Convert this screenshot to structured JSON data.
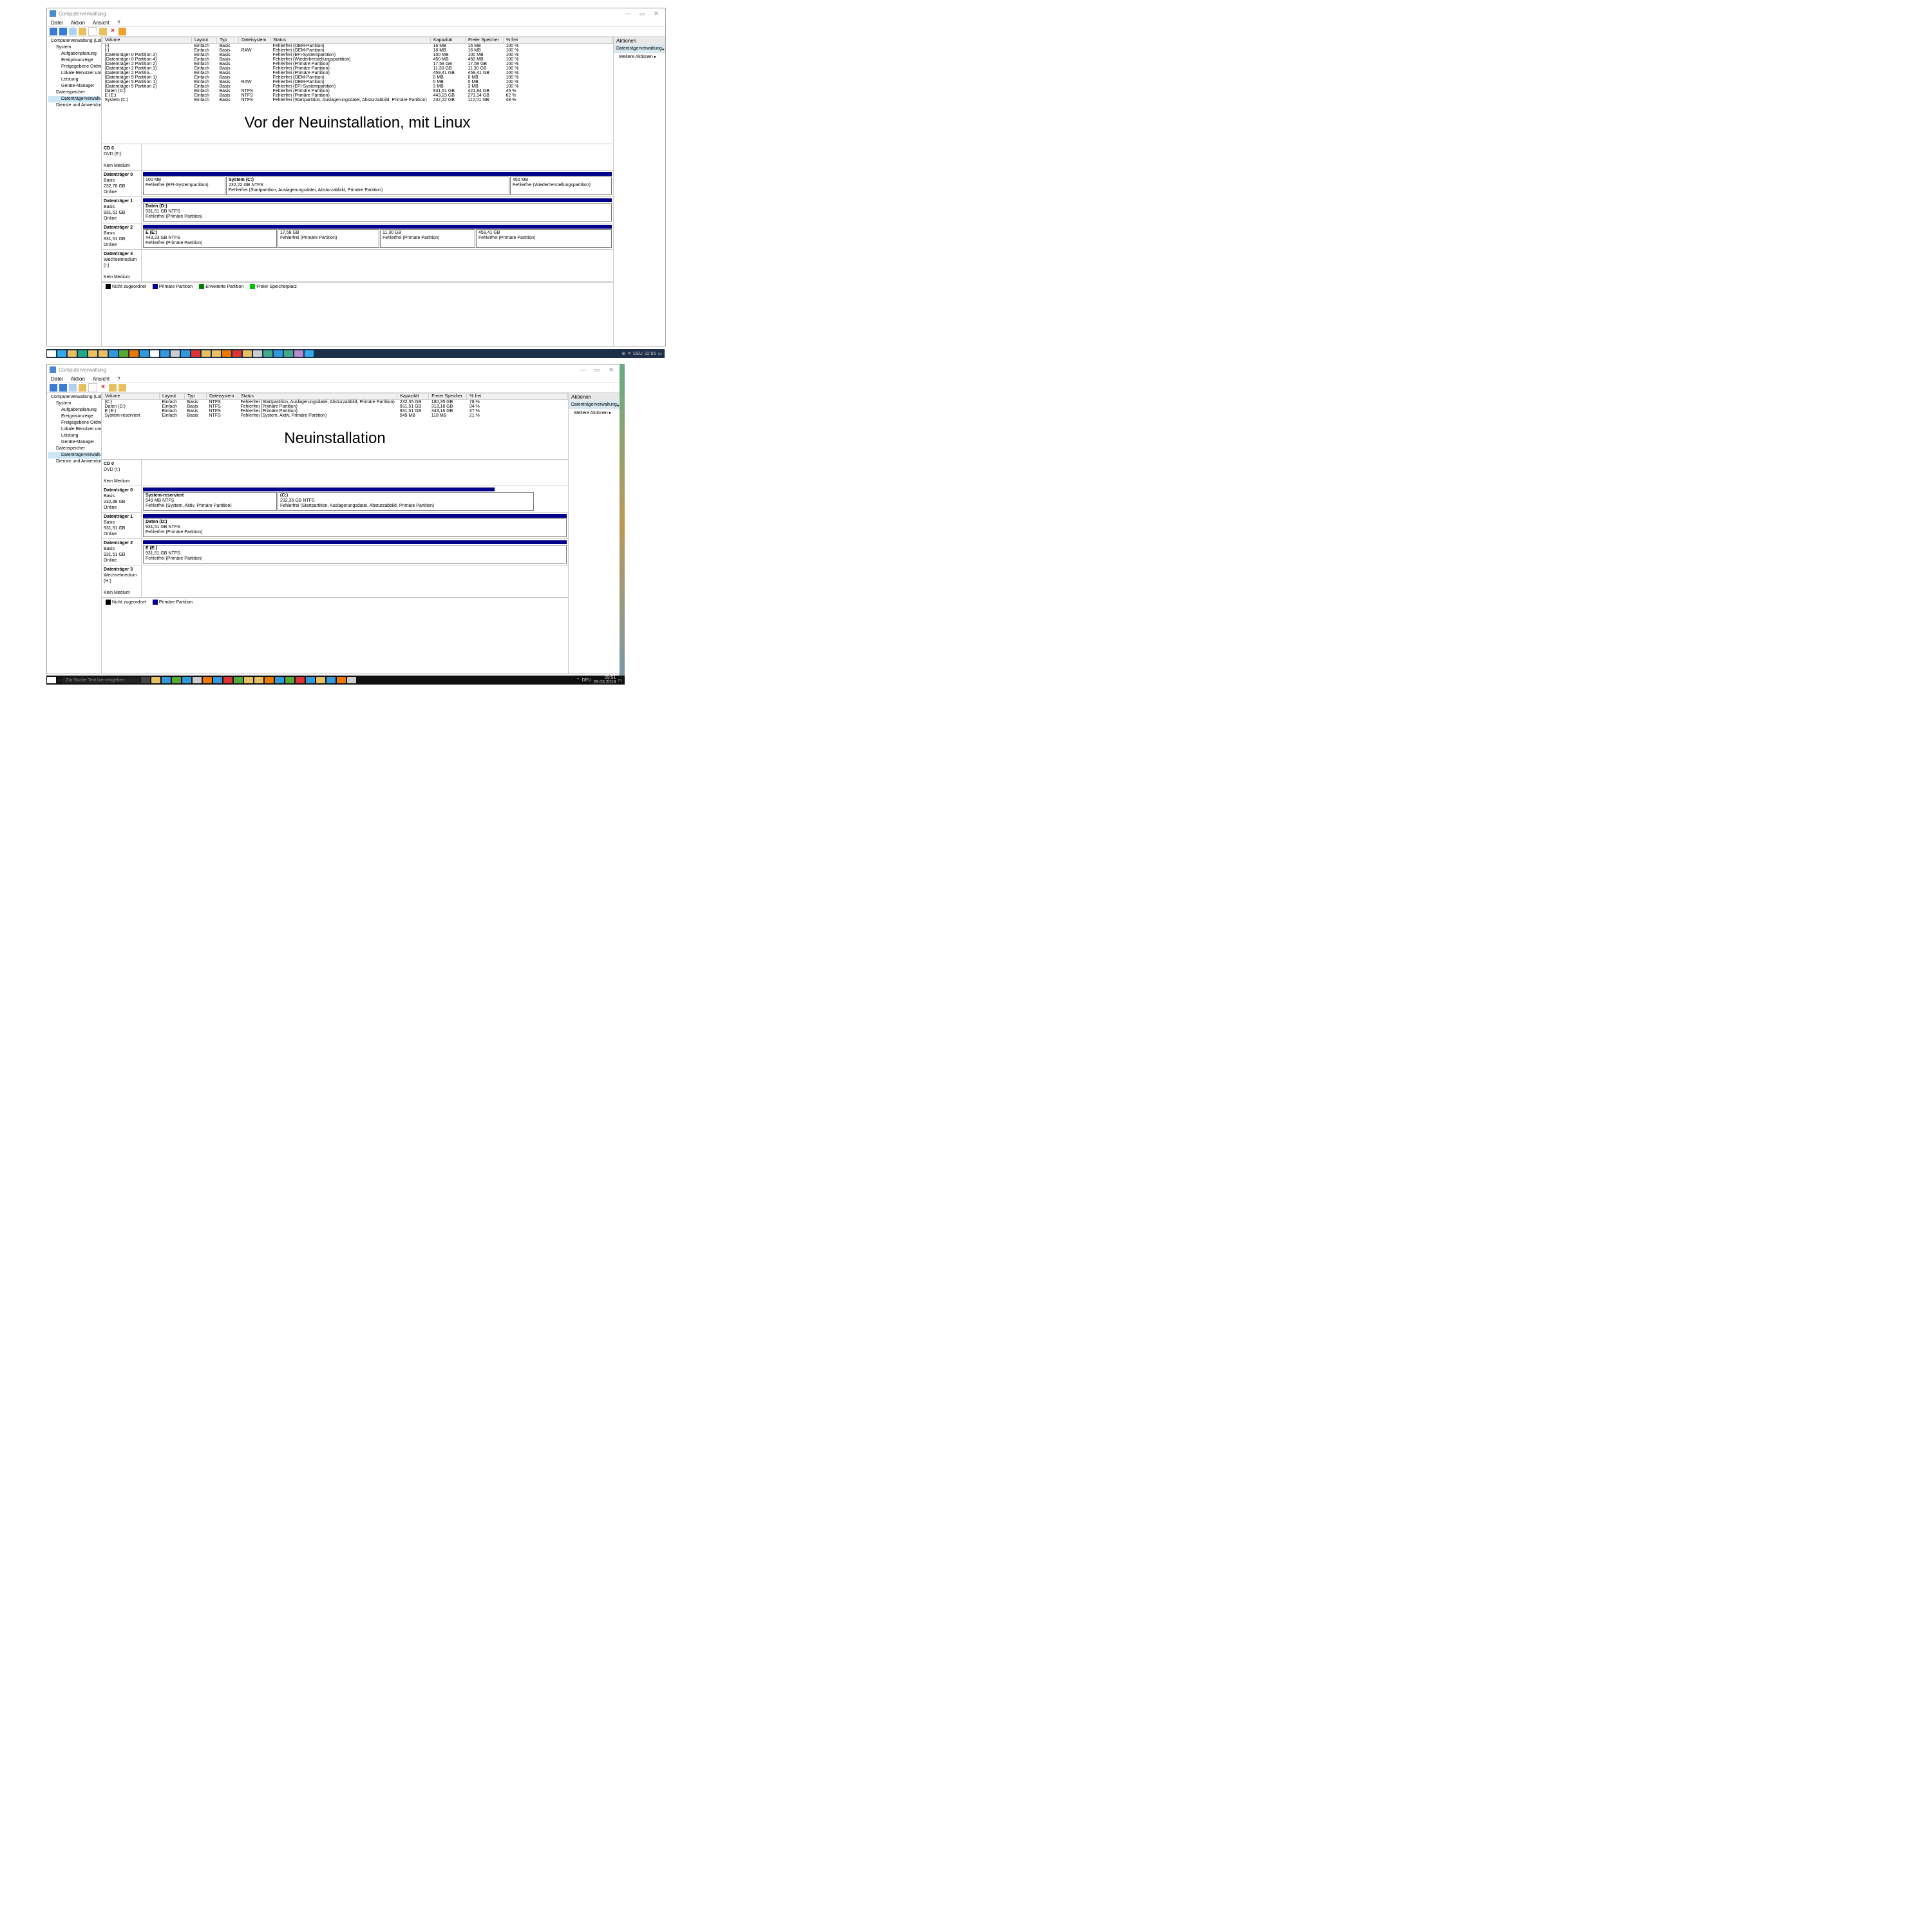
{
  "app_title": "Computerverwaltung",
  "menu": [
    "Datei",
    "Aktion",
    "Ansicht",
    "?"
  ],
  "tree": {
    "root": "Computerverwaltung (Lokal)",
    "system": "System",
    "items": [
      "Aufgabenplanung",
      "Ereignisanzeige",
      "Freigegebene Ordner",
      "Lokale Benutzer und Gr",
      "Leistung",
      "Geräte-Manager"
    ],
    "storage": "Datenspeicher",
    "disk": "Datenträgerverwaltung",
    "services": "Dienste und Anwendungen"
  },
  "cols": [
    "Volume",
    "Layout",
    "Typ",
    "Dateisystem",
    "Status",
    "Kapazität",
    "Freier Speicher",
    "% frei"
  ],
  "top": {
    "rows": [
      [
        "(-)",
        "Einfach",
        "Basis",
        "",
        "Fehlerfrei (OEM-Partition)",
        "16 MB",
        "16 MB",
        "100 %"
      ],
      [
        "(-)",
        "Einfach",
        "Basis",
        "RAW",
        "Fehlerfrei (OEM-Partition)",
        "16 MB",
        "16 MB",
        "100 %"
      ],
      [
        "(Datenträger 0 Partition 2)",
        "Einfach",
        "Basis",
        "",
        "Fehlerfrei (EFI-Systempartition)",
        "100 MB",
        "100 MB",
        "100 %"
      ],
      [
        "(Datenträger 0 Partition 4)",
        "Einfach",
        "Basis",
        "",
        "Fehlerfrei (Wiederherstellungspartition)",
        "450 MB",
        "450 MB",
        "100 %"
      ],
      [
        "(Datenträger 2 Partition 2)",
        "Einfach",
        "Basis",
        "",
        "Fehlerfrei (Primäre Partition)",
        "17,58 GB",
        "17,58 GB",
        "100 %"
      ],
      [
        "(Datenträger 2 Partition 3)",
        "Einfach",
        "Basis",
        "",
        "Fehlerfrei (Primäre Partition)",
        "11,30 GB",
        "11,30 GB",
        "100 %"
      ],
      [
        "(Datenträger 2 Partitio...",
        "Einfach",
        "Basis",
        "",
        "Fehlerfrei (Primäre Partition)",
        "459,41 GB",
        "459,41 GB",
        "100 %"
      ],
      [
        "(Datenträger 5 Partition 1)",
        "Einfach",
        "Basis",
        "",
        "Fehlerfrei (OEM-Partition)",
        "0 MB",
        "0 MB",
        "100 %"
      ],
      [
        "(Datenträger 5 Partition 1)",
        "Einfach",
        "Basis",
        "RAW",
        "Fehlerfrei (OEM-Partition)",
        "0 MB",
        "0 MB",
        "100 %"
      ],
      [
        "(Datenträger 5 Partition 2)",
        "Einfach",
        "Basis",
        "",
        "Fehlerfrei (EFI-Systempartition)",
        "3 MB",
        "3 MB",
        "100 %"
      ],
      [
        "Daten (D:)",
        "Einfach",
        "Basis",
        "NTFS",
        "Fehlerfrei (Primäre Partition)",
        "931,51 GB",
        "421,84 GB",
        "45 %"
      ],
      [
        "E (E:)",
        "Einfach",
        "Basis",
        "NTFS",
        "Fehlerfrei (Primäre Partition)",
        "443,23 GB",
        "273,14 GB",
        "62 %"
      ],
      [
        "System (C:)",
        "Einfach",
        "Basis",
        "NTFS",
        "Fehlerfrei (Startpartition, Auslagerungsdatei, Absturzabbild, Primäre Partition)",
        "232,22 GB",
        "112,01 GB",
        "48 %"
      ]
    ],
    "caption": "Vor der Neuinstallation, mit Linux",
    "cd": {
      "name": "CD 0",
      "sub": "DVD (F:)",
      "txt": "Kein Medium"
    },
    "d0": {
      "name": "Datenträger 0",
      "type": "Basis",
      "size": "232,76 GB",
      "state": "Online",
      "p1": "100 MB",
      "p1s": "Fehlerfrei (EFI-Systempartition)",
      "p2": "System  (C:)",
      "p2b": "232,22 GB NTFS",
      "p2s": "Fehlerfrei (Startpartition, Auslagerungsdatei, Absturzabbild, Primäre Partition)",
      "p3": "450 MB",
      "p3s": "Fehlerfrei (Wiederherstellungspartition)"
    },
    "d1": {
      "name": "Datenträger 1",
      "type": "Basis",
      "size": "931,51 GB",
      "state": "Online",
      "p1": "Daten  (D:)",
      "p1b": "931,51 GB NTFS",
      "p1s": "Fehlerfrei (Primäre Partition)"
    },
    "d2": {
      "name": "Datenträger 2",
      "type": "Basis",
      "size": "931,51 GB",
      "state": "Online",
      "p1": "E  (E:)",
      "p1b": "443,23 GB NTFS",
      "p1s": "Fehlerfrei (Primäre Partition)",
      "p2": "17,58 GB",
      "p2s": "Fehlerfrei (Primäre Partition)",
      "p3": "11,30 GB",
      "p3s": "Fehlerfrei (Primäre Partition)",
      "p4": "459,41 GB",
      "p4s": "Fehlerfrei (Primäre Partition)"
    },
    "d3": {
      "name": "Datenträger 3",
      "sub": "Wechselmedium (I:)",
      "txt": "Kein Medium"
    }
  },
  "legend": {
    "l1": "Nicht zugeordnet",
    "l2": "Primäre Partition",
    "l3": "Erweiterte Partition",
    "l4": "Freier Speicherplatz"
  },
  "actions": {
    "hdr": "Aktionen",
    "row": "Datenträgerverwaltung",
    "row2": "Weitere Aktionen"
  },
  "tray1": {
    "lang": "DEU",
    "time": "22:55"
  },
  "bottom": {
    "title": "Computerverwaltung",
    "tree_root": "Computerverwaltung (Lokal)",
    "rows": [
      [
        "(C:)",
        "Einfach",
        "Basis",
        "NTFS",
        "Fehlerfrei (Startpartition, Auslagerungsdatei, Absturzabbild, Primäre Partition)",
        "232,35 GB",
        "180,35 GB",
        "78 %"
      ],
      [
        "Daten (D:)",
        "Einfach",
        "Basis",
        "NTFS",
        "Fehlerfrei (Primäre Partition)",
        "931,51 GB",
        "313,18 GB",
        "34 %"
      ],
      [
        "E (E:)",
        "Einfach",
        "Basis",
        "NTFS",
        "Fehlerfrei (Primäre Partition)",
        "931,51 GB",
        "343,16 GB",
        "37 %"
      ],
      [
        "System-reserviert",
        "Einfach",
        "Basis",
        "NTFS",
        "Fehlerfrei (System, Aktiv, Primäre Partition)",
        "549 MB",
        "118 MB",
        "21 %"
      ]
    ],
    "caption": "Neuinstallation",
    "cd": {
      "name": "CD 0",
      "sub": "DVD (I:)",
      "txt": "Kein Medium"
    },
    "d0": {
      "name": "Datenträger 0",
      "type": "Basis",
      "size": "232,88 GB",
      "state": "Online",
      "p1": "System-reserviert",
      "p1b": "549 MB NTFS",
      "p1s": "Fehlerfrei (System, Aktiv, Primäre Partition)",
      "p2": "(C:)",
      "p2b": "232,35 GB NTFS",
      "p2s": "Fehlerfrei (Startpartition, Auslagerungsdatei, Absturzabbild, Primäre Partition)"
    },
    "d1": {
      "name": "Datenträger 1",
      "type": "Basis",
      "size": "931,51 GB",
      "state": "Online",
      "p1": "Daten  (D:)",
      "p1b": "931,51 GB NTFS",
      "p1s": "Fehlerfrei (Primäre Partition)"
    },
    "d2": {
      "name": "Datenträger 2",
      "type": "Basis",
      "size": "931,51 GB",
      "state": "Online",
      "p1": "E  (E:)",
      "p1b": "931,51 GB NTFS",
      "p1s": "Fehlerfrei (Primäre Partition)"
    },
    "d3": {
      "name": "Datenträger 3",
      "sub": "Wechselmedium (H:)",
      "txt": "Kein Medium"
    }
  },
  "tray2": {
    "lang": "DEU",
    "time": "09:51",
    "date": "29.03.2019",
    "search": "Zur Suche Text hier eingeben"
  }
}
